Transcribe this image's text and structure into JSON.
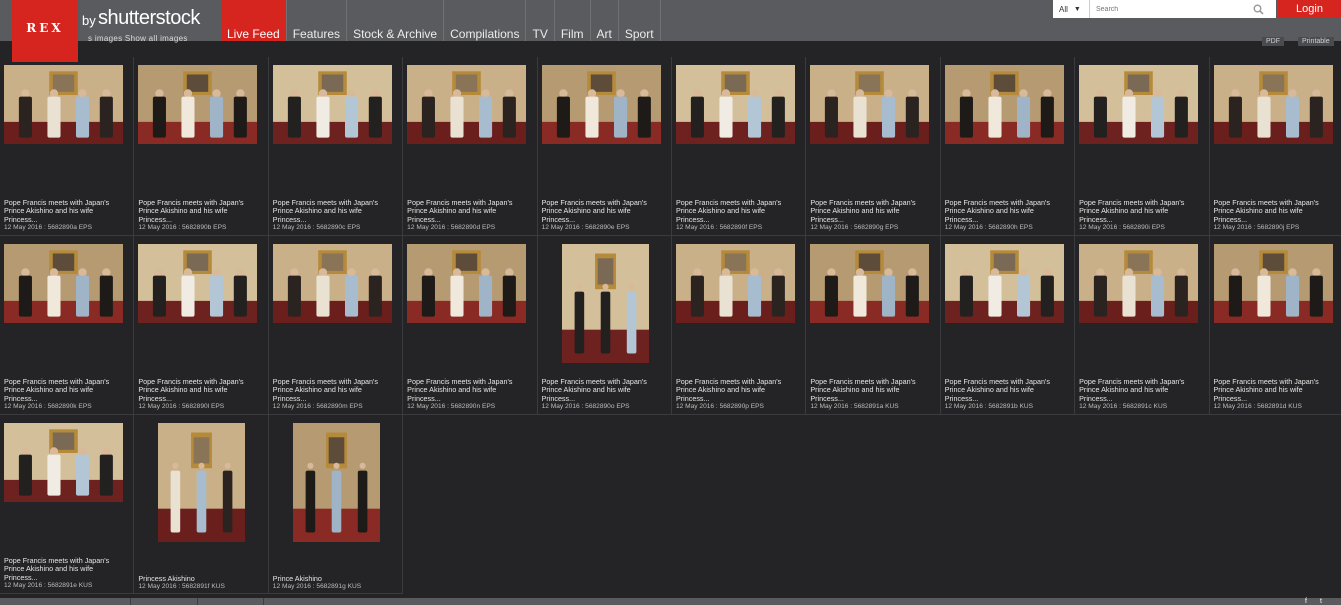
{
  "brand": {
    "logo_text": "REX",
    "by": "by",
    "name": "shutterstock",
    "logo_color": "#d6241f"
  },
  "nav": {
    "items": [
      "Live Feed",
      "Features",
      "Stock & Archive",
      "Compilations",
      "TV",
      "Film",
      "Art",
      "Sport"
    ],
    "active_index": 0
  },
  "search": {
    "filter": "All",
    "placeholder": "Search",
    "value": ""
  },
  "login": "Login",
  "toolbar": {
    "overflow": "s images   Show all images",
    "pdf": "PDF",
    "printable": "Printable"
  },
  "images": [
    {
      "caption": "Pope Francis meets with Japan's Prince Akishino and his wife Princess...",
      "meta": "12 May 2016 : 5682890a EPS",
      "orientation": "land"
    },
    {
      "caption": "Pope Francis meets with Japan's Prince Akishino and his wife Princess...",
      "meta": "12 May 2016 : 5682890b EPS",
      "orientation": "land"
    },
    {
      "caption": "Pope Francis meets with Japan's Prince Akishino and his wife Princess...",
      "meta": "12 May 2016 : 5682890c EPS",
      "orientation": "land"
    },
    {
      "caption": "Pope Francis meets with Japan's Prince Akishino and his wife Princess...",
      "meta": "12 May 2016 : 5682890d EPS",
      "orientation": "land"
    },
    {
      "caption": "Pope Francis meets with Japan's Prince Akishino and his wife Princess...",
      "meta": "12 May 2016 : 5682890e EPS",
      "orientation": "land"
    },
    {
      "caption": "Pope Francis meets with Japan's Prince Akishino and his wife Princess...",
      "meta": "12 May 2016 : 5682890f EPS",
      "orientation": "land"
    },
    {
      "caption": "Pope Francis meets with Japan's Prince Akishino and his wife Princess...",
      "meta": "12 May 2016 : 5682890g EPS",
      "orientation": "land"
    },
    {
      "caption": "Pope Francis meets with Japan's Prince Akishino and his wife Princess...",
      "meta": "12 May 2016 : 5682890h EPS",
      "orientation": "land"
    },
    {
      "caption": "Pope Francis meets with Japan's Prince Akishino and his wife Princess...",
      "meta": "12 May 2016 : 5682890i EPS",
      "orientation": "land"
    },
    {
      "caption": "Pope Francis meets with Japan's Prince Akishino and his wife Princess...",
      "meta": "12 May 2016 : 5682890j EPS",
      "orientation": "land"
    },
    {
      "caption": "Pope Francis meets with Japan's Prince Akishino and his wife Princess...",
      "meta": "12 May 2016 : 5682890k EPS",
      "orientation": "land"
    },
    {
      "caption": "Pope Francis meets with Japan's Prince Akishino and his wife Princess...",
      "meta": "12 May 2016 : 5682890l EPS",
      "orientation": "land"
    },
    {
      "caption": "Pope Francis meets with Japan's Prince Akishino and his wife Princess...",
      "meta": "12 May 2016 : 5682890m EPS",
      "orientation": "land"
    },
    {
      "caption": "Pope Francis meets with Japan's Prince Akishino and his wife Princess...",
      "meta": "12 May 2016 : 5682890n EPS",
      "orientation": "land"
    },
    {
      "caption": "Pope Francis meets with Japan's Prince Akishino and his wife Princess...",
      "meta": "12 May 2016 : 5682890o EPS",
      "orientation": "port"
    },
    {
      "caption": "Pope Francis meets with Japan's Prince Akishino and his wife Princess...",
      "meta": "12 May 2016 : 5682890p EPS",
      "orientation": "land"
    },
    {
      "caption": "Pope Francis meets with Japan's Prince Akishino and his wife Princess...",
      "meta": "12 May 2016 : 5682891a KUS",
      "orientation": "land"
    },
    {
      "caption": "Pope Francis meets with Japan's Prince Akishino and his wife Princess...",
      "meta": "12 May 2016 : 5682891b KUS",
      "orientation": "land"
    },
    {
      "caption": "Pope Francis meets with Japan's Prince Akishino and his wife Princess...",
      "meta": "12 May 2016 : 5682891c KUS",
      "orientation": "land"
    },
    {
      "caption": "Pope Francis meets with Japan's Prince Akishino and his wife Princess...",
      "meta": "12 May 2016 : 5682891d KUS",
      "orientation": "land"
    },
    {
      "caption": "Pope Francis meets with Japan's Prince Akishino and his wife Princess...",
      "meta": "12 May 2016 : 5682891e KUS",
      "orientation": "land"
    },
    {
      "caption": "Princess Akishino",
      "meta": "12 May 2016 : 5682891f KUS",
      "orientation": "port"
    },
    {
      "caption": "Prince Akishino",
      "meta": "12 May 2016 : 5682891g KUS",
      "orientation": "port"
    }
  ]
}
